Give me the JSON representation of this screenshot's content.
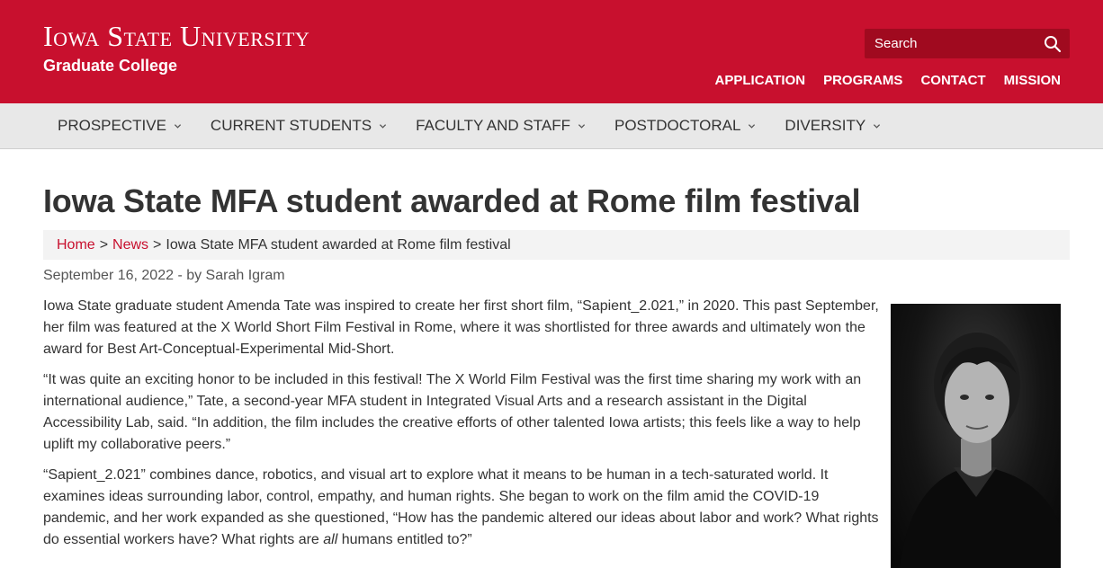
{
  "header": {
    "wordmark": "Iowa State University",
    "college": "Graduate College",
    "search_placeholder": "Search",
    "utility_links": [
      "APPLICATION",
      "PROGRAMS",
      "CONTACT",
      "MISSION"
    ],
    "brand_color": "#c8102e"
  },
  "nav": {
    "items": [
      "PROSPECTIVE",
      "CURRENT STUDENTS",
      "FACULTY AND STAFF",
      "POSTDOCTORAL",
      "DIVERSITY"
    ]
  },
  "article": {
    "title": "Iowa State MFA student awarded at Rome film festival",
    "breadcrumb": {
      "home": "Home",
      "sep1": ">",
      "news": "News",
      "sep2": ">",
      "current": "Iowa State MFA student awarded at Rome film festival"
    },
    "byline": "September 16, 2022 - by Sarah Igram",
    "p1": "Iowa State graduate student Amenda Tate was inspired to create her first short film, “Sapient_2.021,” in 2020. This past September, her film was featured at the X World Short Film Festival in Rome, where it was shortlisted for three awards and ultimately won the award for Best Art-Conceptual-Experimental Mid-Short.",
    "p2": "“It was quite an exciting honor to be included in this festival! The X World Film Festival was the first time sharing my work with an international audience,” Tate, a second-year MFA student in Integrated Visual Arts and a research assistant in the Digital Accessibility Lab, said. “In addition, the film includes the creative efforts of other talented Iowa artists; this feels like a way to help uplift my collaborative peers.”",
    "p3_before": "“Sapient_2.021” combines dance, robotics, and visual art to explore what it means to be human in a tech-saturated world. It examines ideas surrounding labor, control, empathy, and human rights. She began to work on the film amid the COVID-19 pandemic, and her work expanded as she questioned, “How has the pandemic altered our ideas about labor and work? What rights do essential workers have? What rights are ",
    "p3_em": "all",
    "p3_after": " humans entitled to?”"
  }
}
